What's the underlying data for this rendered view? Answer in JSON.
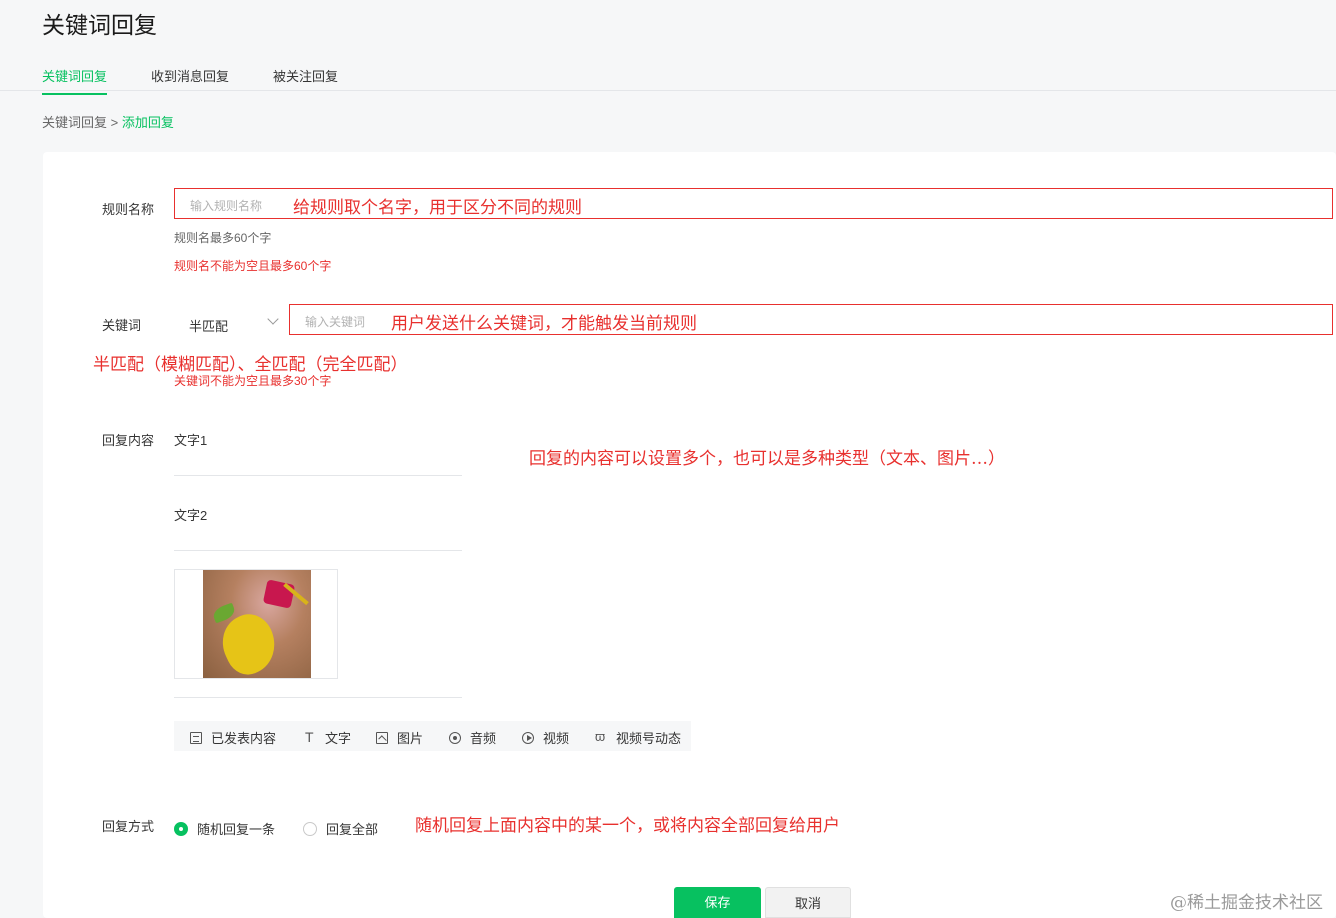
{
  "page_title": "关键词回复",
  "tabs": [
    "关键词回复",
    "收到消息回复",
    "被关注回复"
  ],
  "breadcrumb": {
    "parent": "关键词回复",
    "separator": ">",
    "current": "添加回复"
  },
  "rule_name": {
    "label": "规则名称",
    "placeholder": "输入规则名称",
    "annotation": "给规则取个名字，用于区分不同的规则",
    "hint": "规则名最多60个字",
    "error": "规则名不能为空且最多60个字"
  },
  "keyword": {
    "label": "关键词",
    "match_mode": "半匹配",
    "placeholder": "输入关键词",
    "annotation": "用户发送什么关键词，才能触发当前规则",
    "match_annotation": "半匹配（模糊匹配）、全匹配（完全匹配）",
    "error": "关键词不能为空且最多30个字"
  },
  "reply_content": {
    "label": "回复内容",
    "items": [
      "文字1",
      "文字2"
    ],
    "annotation": "回复的内容可以设置多个，也可以是多种类型（文本、图片…）",
    "toolbar": [
      "已发表内容",
      "文字",
      "图片",
      "音频",
      "视频",
      "视频号动态"
    ]
  },
  "reply_mode": {
    "label": "回复方式",
    "options": [
      "随机回复一条",
      "回复全部"
    ],
    "selected": "随机回复一条",
    "annotation": "随机回复上面内容中的某一个，或将内容全部回复给用户"
  },
  "actions": {
    "save": "保存",
    "cancel": "取消"
  },
  "watermark": "@稀土掘金技术社区",
  "colors": {
    "accent": "#07c160",
    "annotation": "#e8302e"
  }
}
